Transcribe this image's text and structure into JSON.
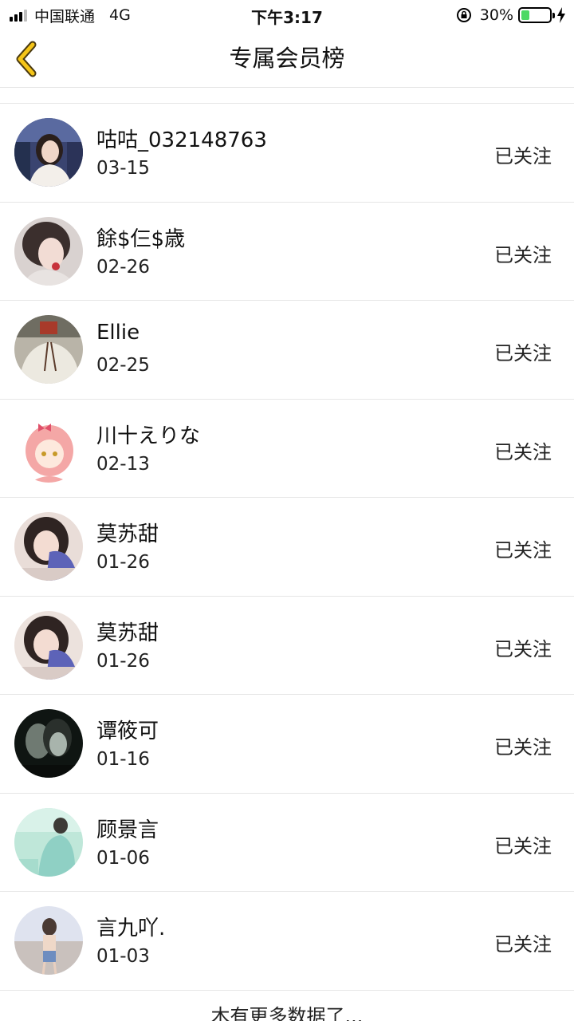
{
  "status_bar": {
    "carrier": "中国联通",
    "network": "4G",
    "time": "下午3:17",
    "battery_percent": "30%",
    "battery_level": 0.3,
    "battery_color": "#4cd964"
  },
  "nav": {
    "back_icon": "chevron-left-icon",
    "back_icon_color": "#f5c518",
    "title": "专属会员榜"
  },
  "members": [
    {
      "name": "咕咕_032148763",
      "date": "03-15",
      "status": "已关注"
    },
    {
      "name": "餘$仨$歳",
      "date": "02-26",
      "status": "已关注"
    },
    {
      "name": "Ellie",
      "date": "02-25",
      "status": "已关注"
    },
    {
      "name": "川十えりな",
      "date": "02-13",
      "status": "已关注"
    },
    {
      "name": "莫苏甜",
      "date": "01-26",
      "status": "已关注"
    },
    {
      "name": "莫苏甜",
      "date": "01-26",
      "status": "已关注"
    },
    {
      "name": "谭筱可",
      "date": "01-16",
      "status": "已关注"
    },
    {
      "name": "顾景言",
      "date": "01-06",
      "status": "已关注"
    },
    {
      "name": "言九吖.",
      "date": "01-03",
      "status": "已关注"
    }
  ],
  "footer": {
    "text": "木有更多数据了..."
  }
}
